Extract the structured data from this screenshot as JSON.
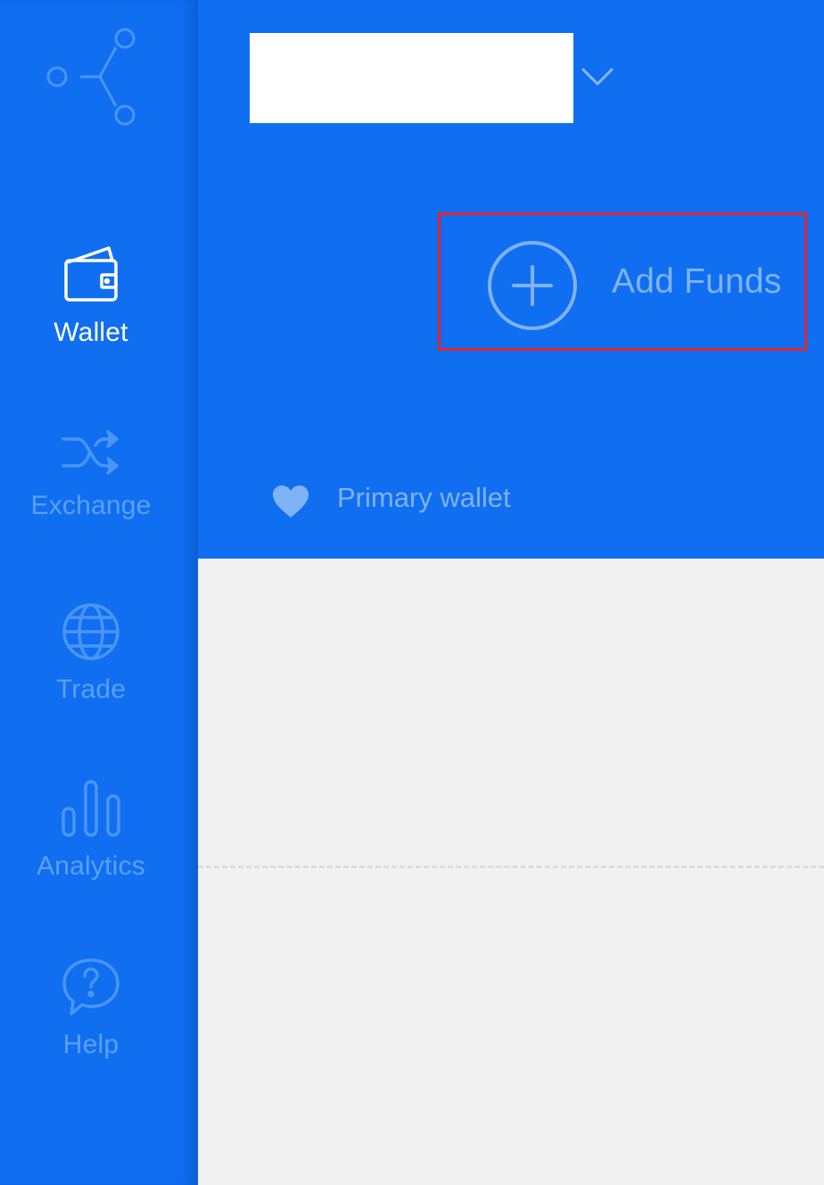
{
  "sidebar": {
    "logo_icon": "network-nodes-icon",
    "items": [
      {
        "label": "Wallet",
        "icon": "wallet-icon",
        "active": true
      },
      {
        "label": "Exchange",
        "icon": "shuffle-icon",
        "active": false
      },
      {
        "label": "Trade",
        "icon": "globe-icon",
        "active": false
      },
      {
        "label": "Analytics",
        "icon": "bar-chart-icon",
        "active": false
      },
      {
        "label": "Help",
        "icon": "help-bubble-icon",
        "active": false
      }
    ]
  },
  "header": {
    "wallet_name": "",
    "dropdown_icon": "chevron-down-icon",
    "add_funds": {
      "label": "Add Funds",
      "icon": "plus-circle-icon"
    },
    "primary_wallet": {
      "label": "Primary wallet",
      "icon": "heart-icon"
    }
  },
  "colors": {
    "primary_blue": "#106ef1",
    "inactive_text": "#5aa0f5",
    "muted_light_blue": "#7fb2f7",
    "highlight_border": "#e8232b",
    "content_bg": "#f1f1f1"
  }
}
